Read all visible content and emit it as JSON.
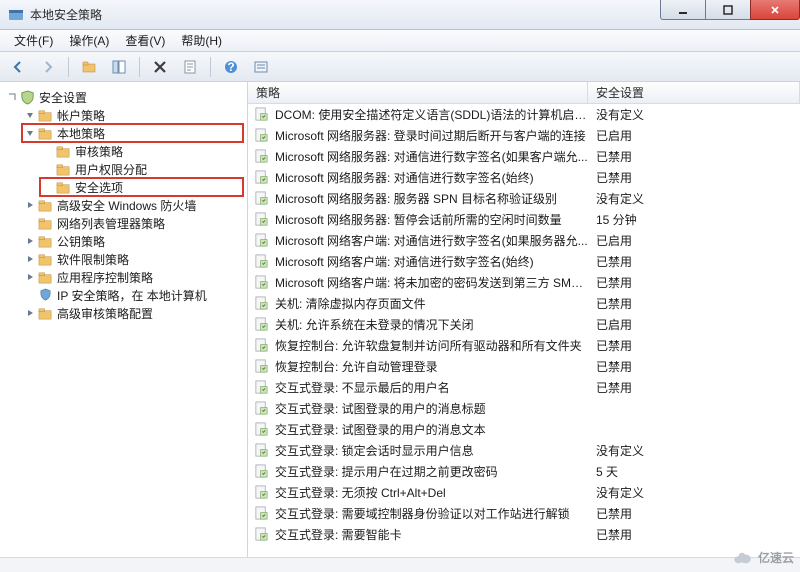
{
  "window": {
    "title": "本地安全策略",
    "controls": {
      "min": "minimize",
      "max": "maximize",
      "close": "close"
    }
  },
  "menu": {
    "file": "文件(F)",
    "action": "操作(A)",
    "view": "查看(V)",
    "help": "帮助(H)"
  },
  "toolbar_icons": [
    "back",
    "forward",
    "up",
    "show-hide-tree",
    "export",
    "delete",
    "properties",
    "help",
    "refresh"
  ],
  "tree": {
    "root": "安全设置",
    "items": [
      {
        "label": "帐户策略",
        "icon": "folder",
        "expanded": true
      },
      {
        "label": "本地策略",
        "icon": "folder",
        "expanded": true,
        "highlight": true,
        "children": [
          {
            "label": "审核策略",
            "icon": "folder"
          },
          {
            "label": "用户权限分配",
            "icon": "folder"
          },
          {
            "label": "安全选项",
            "icon": "folder",
            "highlight": true
          }
        ]
      },
      {
        "label": "高级安全 Windows 防火墙",
        "icon": "folder"
      },
      {
        "label": "网络列表管理器策略",
        "icon": "folder-plain"
      },
      {
        "label": "公钥策略",
        "icon": "folder"
      },
      {
        "label": "软件限制策略",
        "icon": "folder"
      },
      {
        "label": "应用程序控制策略",
        "icon": "folder"
      },
      {
        "label": "IP 安全策略，在 本地计算机",
        "icon": "shield"
      },
      {
        "label": "高级审核策略配置",
        "icon": "folder"
      }
    ]
  },
  "list": {
    "headers": {
      "policy": "策略",
      "setting": "安全设置"
    },
    "rows": [
      {
        "policy": "DCOM: 使用安全描述符定义语言(SDDL)语法的计算机启动...",
        "setting": "没有定义"
      },
      {
        "policy": "Microsoft 网络服务器: 登录时间过期后断开与客户端的连接",
        "setting": "已启用"
      },
      {
        "policy": "Microsoft 网络服务器: 对通信进行数字签名(如果客户端允...",
        "setting": "已禁用"
      },
      {
        "policy": "Microsoft 网络服务器: 对通信进行数字签名(始终)",
        "setting": "已禁用"
      },
      {
        "policy": "Microsoft 网络服务器: 服务器 SPN 目标名称验证级别",
        "setting": "没有定义"
      },
      {
        "policy": "Microsoft 网络服务器: 暂停会话前所需的空闲时间数量",
        "setting": "15 分钟"
      },
      {
        "policy": "Microsoft 网络客户端: 对通信进行数字签名(如果服务器允...",
        "setting": "已启用"
      },
      {
        "policy": "Microsoft 网络客户端: 对通信进行数字签名(始终)",
        "setting": "已禁用"
      },
      {
        "policy": "Microsoft 网络客户端: 将未加密的密码发送到第三方 SMB...",
        "setting": "已禁用"
      },
      {
        "policy": "关机: 清除虚拟内存页面文件",
        "setting": "已禁用"
      },
      {
        "policy": "关机: 允许系统在未登录的情况下关闭",
        "setting": "已启用"
      },
      {
        "policy": "恢复控制台: 允许软盘复制并访问所有驱动器和所有文件夹",
        "setting": "已禁用"
      },
      {
        "policy": "恢复控制台: 允许自动管理登录",
        "setting": "已禁用"
      },
      {
        "policy": "交互式登录: 不显示最后的用户名",
        "setting": "已禁用"
      },
      {
        "policy": "交互式登录: 试图登录的用户的消息标题",
        "setting": ""
      },
      {
        "policy": "交互式登录: 试图登录的用户的消息文本",
        "setting": ""
      },
      {
        "policy": "交互式登录: 锁定会话时显示用户信息",
        "setting": "没有定义"
      },
      {
        "policy": "交互式登录: 提示用户在过期之前更改密码",
        "setting": "5 天"
      },
      {
        "policy": "交互式登录: 无须按 Ctrl+Alt+Del",
        "setting": "没有定义"
      },
      {
        "policy": "交互式登录: 需要域控制器身份验证以对工作站进行解锁",
        "setting": "已禁用"
      },
      {
        "policy": "交互式登录: 需要智能卡",
        "setting": "已禁用"
      }
    ]
  },
  "watermark": "亿速云"
}
